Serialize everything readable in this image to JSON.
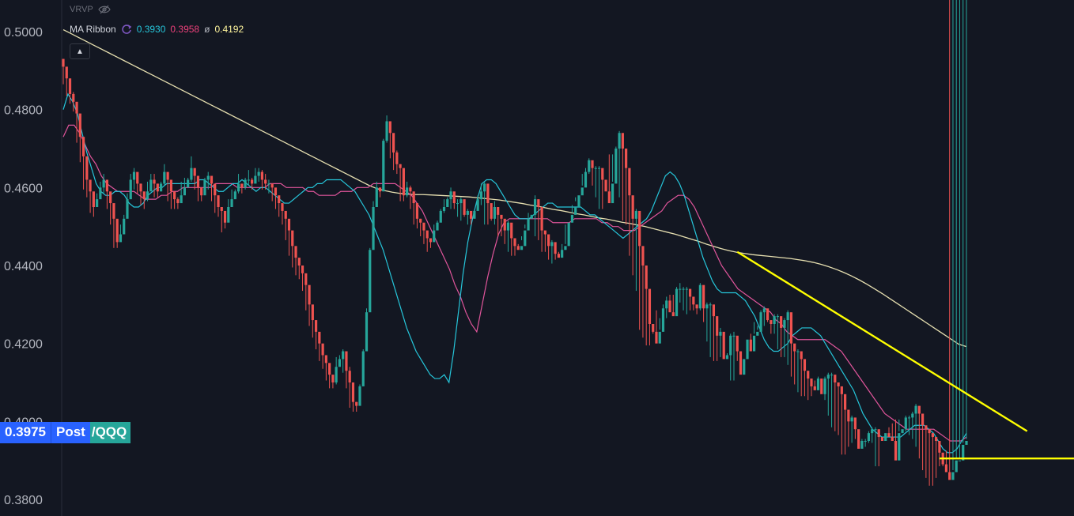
{
  "legend": {
    "vrvp_label": "VRVP",
    "ma_ribbon_label": "MA Ribbon",
    "ma_values": [
      {
        "value": "0.3930",
        "color": "#26c6da"
      },
      {
        "value": "0.3958",
        "color": "#ec407a"
      },
      {
        "value": "0.4192",
        "color": "#fff59d",
        "prefix": "ø"
      }
    ]
  },
  "price_tag": {
    "price": "0.3975",
    "session": "Post",
    "symbol": "/QQQ"
  },
  "colors": {
    "background": "#131722",
    "up": "#26a69a",
    "down": "#ef5350",
    "ma_fast": "#26c6da",
    "ma_mid": "#e0559b",
    "ma_slow": "#e6dfb0",
    "trendline": "#ffff00",
    "accent": "#2962ff"
  },
  "chart_data": {
    "type": "candlestick",
    "ylim": [
      0.3765,
      0.50085
    ],
    "y_ticks": [
      "0.5000",
      "0.4800",
      "0.4600",
      "0.4400",
      "0.4200",
      "0.4000",
      "0.3800"
    ],
    "visible_y_ticks": [
      "0.5000",
      "0.4800",
      "0.4600",
      "0.4400",
      "0.4200",
      "0.3800"
    ],
    "closes": [
      0.491,
      0.488,
      0.484,
      0.482,
      0.479,
      0.473,
      0.468,
      0.462,
      0.459,
      0.455,
      0.457,
      0.46,
      0.462,
      0.459,
      0.456,
      0.452,
      0.446,
      0.448,
      0.452,
      0.457,
      0.462,
      0.464,
      0.461,
      0.459,
      0.457,
      0.459,
      0.462,
      0.461,
      0.459,
      0.461,
      0.464,
      0.462,
      0.459,
      0.457,
      0.456,
      0.458,
      0.46,
      0.462,
      0.465,
      0.463,
      0.46,
      0.458,
      0.462,
      0.463,
      0.461,
      0.458,
      0.455,
      0.454,
      0.451,
      0.455,
      0.457,
      0.459,
      0.461,
      0.46,
      0.462,
      0.462,
      0.461,
      0.463,
      0.464,
      0.462,
      0.461,
      0.461,
      0.46,
      0.458,
      0.456,
      0.454,
      0.452,
      0.449,
      0.445,
      0.442,
      0.44,
      0.438,
      0.435,
      0.43,
      0.426,
      0.423,
      0.42,
      0.417,
      0.415,
      0.412,
      0.41,
      0.414,
      0.416,
      0.418,
      0.413,
      0.41,
      0.405,
      0.404,
      0.409,
      0.418,
      0.428,
      0.444,
      0.455,
      0.46,
      0.459,
      0.472,
      0.477,
      0.474,
      0.469,
      0.466,
      0.465,
      0.458,
      0.46,
      0.459,
      0.456,
      0.452,
      0.451,
      0.449,
      0.447,
      0.446,
      0.449,
      0.451,
      0.454,
      0.455,
      0.457,
      0.459,
      0.456,
      0.456,
      0.457,
      0.453,
      0.454,
      0.452,
      0.454,
      0.457,
      0.459,
      0.461,
      0.456,
      0.452,
      0.455,
      0.453,
      0.452,
      0.449,
      0.451,
      0.447,
      0.445,
      0.444,
      0.445,
      0.449,
      0.452,
      0.453,
      0.457,
      0.455,
      0.449,
      0.448,
      0.445,
      0.446,
      0.443,
      0.442,
      0.444,
      0.445,
      0.451,
      0.453,
      0.455,
      0.458,
      0.46,
      0.464,
      0.467,
      0.465,
      0.465,
      0.465,
      0.462,
      0.459,
      0.456,
      0.461,
      0.47,
      0.474,
      0.47,
      0.465,
      0.458,
      0.452,
      0.454,
      0.445,
      0.44,
      0.434,
      0.425,
      0.423,
      0.42,
      0.423,
      0.429,
      0.431,
      0.428,
      0.427,
      0.434,
      0.434,
      0.434,
      0.434,
      0.432,
      0.43,
      0.429,
      0.435,
      0.429,
      0.43,
      0.43,
      0.427,
      0.422,
      0.423,
      0.416,
      0.417,
      0.422,
      0.422,
      0.418,
      0.412,
      0.416,
      0.421,
      0.418,
      0.422,
      0.423,
      0.428,
      0.429,
      0.426,
      0.425,
      0.427,
      0.427,
      0.424,
      0.426,
      0.428,
      0.42,
      0.418,
      0.418,
      0.416,
      0.413,
      0.411,
      0.409,
      0.408,
      0.411,
      0.407,
      0.411,
      0.412,
      0.412,
      0.41,
      0.409,
      0.407,
      0.403,
      0.4,
      0.401,
      0.398,
      0.393,
      0.395,
      0.395,
      0.397,
      0.398,
      0.398,
      0.396,
      0.395,
      0.397,
      0.396,
      0.395,
      0.39,
      0.397,
      0.398,
      0.401,
      0.401,
      0.402,
      0.404,
      0.402,
      0.399,
      0.398,
      0.397,
      0.396,
      0.395,
      0.392,
      0.389,
      0.387,
      0.385,
      0.387,
      0.39,
      0.39,
      0.394,
      0.395
    ],
    "highs": [
      0.4925,
      0.4905,
      0.486,
      0.4845,
      0.4805,
      0.4745,
      0.4715,
      0.4625,
      0.461,
      0.4575,
      0.4585,
      0.4615,
      0.4635,
      0.462,
      0.4575,
      0.4545,
      0.4495,
      0.4505,
      0.453,
      0.4585,
      0.4635,
      0.465,
      0.4625,
      0.461,
      0.4585,
      0.4615,
      0.4635,
      0.4635,
      0.461,
      0.4615,
      0.466,
      0.4635,
      0.4615,
      0.4575,
      0.4575,
      0.4615,
      0.4625,
      0.4625,
      0.468,
      0.4645,
      0.4615,
      0.459,
      0.4625,
      0.464,
      0.4625,
      0.4595,
      0.458,
      0.4545,
      0.4535,
      0.457,
      0.4595,
      0.4595,
      0.4635,
      0.4605,
      0.4625,
      0.4645,
      0.4625,
      0.465,
      0.465,
      0.4645,
      0.4635,
      0.462,
      0.461,
      0.4595,
      0.4575,
      0.4555,
      0.4525,
      0.4505,
      0.4455,
      0.4425,
      0.4415,
      0.439,
      0.4365,
      0.4305,
      0.427,
      0.4235,
      0.4205,
      0.418,
      0.4155,
      0.4125,
      0.4105,
      0.4165,
      0.417,
      0.4185,
      0.4165,
      0.414,
      0.407,
      0.405,
      0.4095,
      0.4185,
      0.429,
      0.4445,
      0.4565,
      0.4615,
      0.4595,
      0.4725,
      0.4785,
      0.4755,
      0.4715,
      0.4695,
      0.466,
      0.4595,
      0.4615,
      0.4605,
      0.4585,
      0.4535,
      0.452,
      0.45,
      0.4475,
      0.4465,
      0.4505,
      0.4515,
      0.4545,
      0.457,
      0.4575,
      0.46,
      0.4575,
      0.457,
      0.4575,
      0.4545,
      0.4545,
      0.4525,
      0.4545,
      0.458,
      0.461,
      0.4615,
      0.4575,
      0.4535,
      0.4565,
      0.454,
      0.4525,
      0.4505,
      0.4515,
      0.4475,
      0.446,
      0.4455,
      0.4465,
      0.4495,
      0.4535,
      0.4545,
      0.458,
      0.4565,
      0.4495,
      0.4485,
      0.4455,
      0.4465,
      0.4435,
      0.4425,
      0.4455,
      0.4455,
      0.4525,
      0.4535,
      0.4565,
      0.4585,
      0.4605,
      0.465,
      0.4675,
      0.4665,
      0.4655,
      0.4655,
      0.4635,
      0.4595,
      0.4565,
      0.4615,
      0.4705,
      0.4745,
      0.4705,
      0.4655,
      0.4585,
      0.4535,
      0.4545,
      0.4465,
      0.4405,
      0.4345,
      0.4255,
      0.424,
      0.4205,
      0.4235,
      0.43,
      0.432,
      0.4285,
      0.4275,
      0.4345,
      0.4355,
      0.4345,
      0.4345,
      0.4325,
      0.4305,
      0.4295,
      0.4355,
      0.4295,
      0.4305,
      0.4305,
      0.4275,
      0.4225,
      0.424,
      0.4165,
      0.4175,
      0.4225,
      0.423,
      0.4185,
      0.4125,
      0.4165,
      0.4215,
      0.4185,
      0.4225,
      0.4235,
      0.4285,
      0.4295,
      0.4265,
      0.4255,
      0.4275,
      0.4275,
      0.4245,
      0.4265,
      0.4285,
      0.4205,
      0.4185,
      0.4185,
      0.4165,
      0.4135,
      0.4115,
      0.4095,
      0.4085,
      0.4115,
      0.4075,
      0.4115,
      0.4125,
      0.4125,
      0.4105,
      0.4095,
      0.4075,
      0.4035,
      0.4005,
      0.4015,
      0.3985,
      0.3935,
      0.3955,
      0.3955,
      0.3975,
      0.3985,
      0.3985,
      0.3965,
      0.3955,
      0.3975,
      0.3965,
      0.3955,
      0.3905,
      0.3975,
      0.3985,
      0.4015,
      0.4015,
      0.4025,
      0.4045,
      0.4025,
      0.3995,
      0.3985,
      0.3975,
      0.3965,
      0.3955,
      0.3925,
      0.3895,
      0.3875,
      0.3855,
      0.3875,
      0.3905,
      0.3905,
      0.3945,
      0.3955
    ],
    "lows": [
      0.4865,
      0.4835,
      0.4815,
      0.4795,
      0.4715,
      0.4665,
      0.4595,
      0.4575,
      0.4535,
      0.4525,
      0.4555,
      0.4575,
      0.4585,
      0.4545,
      0.4505,
      0.4445,
      0.4445,
      0.4465,
      0.4505,
      0.4545,
      0.4595,
      0.4595,
      0.4585,
      0.4555,
      0.4545,
      0.4565,
      0.4595,
      0.4575,
      0.4575,
      0.4595,
      0.4605,
      0.4565,
      0.4545,
      0.4545,
      0.4545,
      0.4565,
      0.4585,
      0.4605,
      0.4615,
      0.4595,
      0.4565,
      0.4565,
      0.4595,
      0.4595,
      0.4565,
      0.4535,
      0.4525,
      0.4485,
      0.4495,
      0.4525,
      0.4555,
      0.4575,
      0.4585,
      0.4585,
      0.4595,
      0.4605,
      0.4595,
      0.4615,
      0.4615,
      0.4595,
      0.4595,
      0.4585,
      0.4565,
      0.4545,
      0.4525,
      0.4505,
      0.4465,
      0.4425,
      0.4395,
      0.4375,
      0.4365,
      0.4335,
      0.4285,
      0.4245,
      0.4215,
      0.4185,
      0.4155,
      0.4135,
      0.4105,
      0.4085,
      0.4085,
      0.4095,
      0.4145,
      0.4125,
      0.4085,
      0.4035,
      0.4025,
      0.4025,
      0.4075,
      0.4165,
      0.4265,
      0.4425,
      0.4535,
      0.4575,
      0.4575,
      0.4685,
      0.4715,
      0.4675,
      0.4645,
      0.4635,
      0.4565,
      0.4565,
      0.4575,
      0.4545,
      0.4505,
      0.4495,
      0.4475,
      0.4455,
      0.4435,
      0.4445,
      0.4475,
      0.4495,
      0.4535,
      0.4535,
      0.4555,
      0.4545,
      0.4545,
      0.4525,
      0.4515,
      0.4525,
      0.4505,
      0.4505,
      0.4545,
      0.4565,
      0.4555,
      0.4505,
      0.4505,
      0.4515,
      0.4505,
      0.4475,
      0.4475,
      0.4455,
      0.4435,
      0.4425,
      0.4425,
      0.4445,
      0.4475,
      0.4505,
      0.4515,
      0.4545,
      0.4475,
      0.4465,
      0.4435,
      0.4435,
      0.4415,
      0.4405,
      0.4415,
      0.4435,
      0.4435,
      0.4505,
      0.4525,
      0.4555,
      0.4575,
      0.4585,
      0.4635,
      0.4635,
      0.4635,
      0.4605,
      0.4575,
      0.4545,
      0.4545,
      0.4595,
      0.4685,
      0.4685,
      0.4635,
      0.4575,
      0.4515,
      0.4505,
      0.4425,
      0.4375,
      0.4335,
      0.4235,
      0.4215,
      0.4195,
      0.4195,
      0.4225,
      0.4285,
      0.4265,
      0.4255,
      0.4265,
      0.4325,
      0.4325,
      0.4325,
      0.4305,
      0.4285,
      0.4275,
      0.4285,
      0.4285,
      0.4275,
      0.4285,
      0.4255,
      0.4205,
      0.4165,
      0.4155,
      0.4155,
      0.4165,
      0.4205,
      0.4165,
      0.4105,
      0.4105,
      0.4155,
      0.4165,
      0.4165,
      0.4215,
      0.4225,
      0.4255,
      0.4245,
      0.4235,
      0.4245,
      0.4255,
      0.4225,
      0.4225,
      0.4185,
      0.4165,
      0.4165,
      0.4145,
      0.4115,
      0.4095,
      0.4075,
      0.4065,
      0.4065,
      0.4055,
      0.4065,
      0.4105,
      0.4095,
      0.4075,
      0.4055,
      0.4015,
      0.3985,
      0.3975,
      0.3965,
      0.3915,
      0.3915,
      0.3935,
      0.3945,
      0.3955,
      0.3955,
      0.3945,
      0.3935,
      0.3945,
      0.3945,
      0.3885,
      0.3885,
      0.3955,
      0.3975,
      0.3985,
      0.3995,
      0.4005,
      0.4005,
      0.3985,
      0.3975,
      0.3965,
      0.3955,
      0.3935,
      0.3905,
      0.3875,
      0.3855,
      0.3835,
      0.3835,
      0.3855,
      0.3885,
      0.3885,
      0.3925
    ],
    "ma_fast": [
      0.48,
      0.484,
      0.482,
      0.479,
      0.474,
      0.469,
      0.465,
      0.461,
      0.459,
      0.458,
      0.458,
      0.459,
      0.459,
      0.458,
      0.456,
      0.455,
      0.455,
      0.456,
      0.458,
      0.459,
      0.46,
      0.46,
      0.461,
      0.461,
      0.461,
      0.461,
      0.461,
      0.461,
      0.461,
      0.462,
      0.462,
      0.461,
      0.46,
      0.459,
      0.459,
      0.46,
      0.461,
      0.461,
      0.462,
      0.461,
      0.46,
      0.459,
      0.46,
      0.46,
      0.459,
      0.458,
      0.457,
      0.456,
      0.456,
      0.457,
      0.458,
      0.459,
      0.46,
      0.46,
      0.461,
      0.461,
      0.462,
      0.462,
      0.462,
      0.462,
      0.461,
      0.46,
      0.459,
      0.457,
      0.455,
      0.453,
      0.45,
      0.447,
      0.444,
      0.44,
      0.436,
      0.432,
      0.428,
      0.424,
      0.421,
      0.418,
      0.416,
      0.414,
      0.412,
      0.411,
      0.411,
      0.412,
      0.41,
      0.418,
      0.428,
      0.438,
      0.446,
      0.452,
      0.457,
      0.461,
      0.462,
      0.462,
      0.461,
      0.459,
      0.457,
      0.455,
      0.453,
      0.452,
      0.452,
      0.452,
      0.453,
      0.454,
      0.455,
      0.456,
      0.456,
      0.455,
      0.455,
      0.455,
      0.455,
      0.455,
      0.455,
      0.454,
      0.453,
      0.453,
      0.452,
      0.451,
      0.45,
      0.449,
      0.448,
      0.447,
      0.448,
      0.449,
      0.45,
      0.451,
      0.452,
      0.454,
      0.457,
      0.46,
      0.463,
      0.464,
      0.463,
      0.461,
      0.458,
      0.454,
      0.45,
      0.446,
      0.442,
      0.439,
      0.436,
      0.434,
      0.433,
      0.433,
      0.433,
      0.433,
      0.432,
      0.431,
      0.429,
      0.427,
      0.424,
      0.421,
      0.419,
      0.418,
      0.418,
      0.419,
      0.42,
      0.422,
      0.423,
      0.424,
      0.424,
      0.424,
      0.423,
      0.422,
      0.42,
      0.418,
      0.416,
      0.414,
      0.412,
      0.41,
      0.408,
      0.405,
      0.402,
      0.4,
      0.398,
      0.397,
      0.396,
      0.396,
      0.396,
      0.396,
      0.396,
      0.397,
      0.398,
      0.399,
      0.399,
      0.399,
      0.398,
      0.397,
      0.395,
      0.393,
      0.392,
      0.392,
      0.393,
      0.395,
      0.397
    ],
    "ma_mid": [
      0.473,
      0.476,
      0.476,
      0.474,
      0.471,
      0.468,
      0.466,
      0.463,
      0.461,
      0.46,
      0.459,
      0.459,
      0.459,
      0.459,
      0.458,
      0.457,
      0.457,
      0.457,
      0.458,
      0.458,
      0.459,
      0.459,
      0.46,
      0.46,
      0.46,
      0.46,
      0.46,
      0.46,
      0.461,
      0.461,
      0.461,
      0.461,
      0.46,
      0.46,
      0.46,
      0.46,
      0.46,
      0.46,
      0.461,
      0.461,
      0.461,
      0.46,
      0.46,
      0.46,
      0.46,
      0.459,
      0.459,
      0.458,
      0.458,
      0.458,
      0.458,
      0.459,
      0.459,
      0.459,
      0.46,
      0.46,
      0.46,
      0.461,
      0.461,
      0.461,
      0.461,
      0.461,
      0.46,
      0.459,
      0.458,
      0.456,
      0.454,
      0.451,
      0.448,
      0.445,
      0.442,
      0.439,
      0.435,
      0.432,
      0.428,
      0.425,
      0.423,
      0.43,
      0.437,
      0.443,
      0.448,
      0.451,
      0.452,
      0.452,
      0.452,
      0.452,
      0.452,
      0.452,
      0.452,
      0.452,
      0.451,
      0.451,
      0.451,
      0.451,
      0.452,
      0.452,
      0.452,
      0.452,
      0.452,
      0.451,
      0.451,
      0.45,
      0.45,
      0.449,
      0.449,
      0.449,
      0.45,
      0.451,
      0.452,
      0.453,
      0.454,
      0.456,
      0.457,
      0.458,
      0.458,
      0.457,
      0.455,
      0.452,
      0.449,
      0.446,
      0.443,
      0.44,
      0.438,
      0.436,
      0.434,
      0.433,
      0.432,
      0.431,
      0.43,
      0.429,
      0.428,
      0.426,
      0.425,
      0.423,
      0.422,
      0.421,
      0.421,
      0.421,
      0.421,
      0.421,
      0.421,
      0.42,
      0.419,
      0.418,
      0.416,
      0.414,
      0.412,
      0.41,
      0.408,
      0.406,
      0.404,
      0.402,
      0.401,
      0.4,
      0.399,
      0.398,
      0.398,
      0.398,
      0.398,
      0.398,
      0.398,
      0.397,
      0.396,
      0.395,
      0.395,
      0.395,
      0.396
    ],
    "ma_slow": [
      0.5005,
      0.4995,
      0.4985,
      0.4975,
      0.4965,
      0.4955,
      0.4945,
      0.4935,
      0.4925,
      0.4915,
      0.4905,
      0.4895,
      0.4885,
      0.4875,
      0.4865,
      0.4855,
      0.4845,
      0.4835,
      0.4825,
      0.4815,
      0.4805,
      0.4795,
      0.4785,
      0.4775,
      0.4765,
      0.4755,
      0.4745,
      0.4735,
      0.4725,
      0.4715,
      0.4705,
      0.4695,
      0.4685,
      0.4675,
      0.4665,
      0.4655,
      0.4645,
      0.4635,
      0.4625,
      0.4615,
      0.4605,
      0.4597,
      0.4592,
      0.4588,
      0.4585,
      0.4583,
      0.4582,
      0.4582,
      0.4581,
      0.458,
      0.4579,
      0.4578,
      0.4577,
      0.4576,
      0.4574,
      0.4572,
      0.457,
      0.4568,
      0.4565,
      0.4562,
      0.4559,
      0.4555,
      0.4552,
      0.4548,
      0.4544,
      0.4541,
      0.4537,
      0.4533,
      0.453,
      0.4526,
      0.4522,
      0.4519,
      0.4515,
      0.4511,
      0.4508,
      0.4504,
      0.45,
      0.4495,
      0.449,
      0.4485,
      0.448,
      0.4474,
      0.4468,
      0.4462,
      0.4455,
      0.4449,
      0.4443,
      0.4438,
      0.4434,
      0.4431,
      0.4428,
      0.4426,
      0.4424,
      0.4422,
      0.442,
      0.4418,
      0.4415,
      0.4412,
      0.4408,
      0.4403,
      0.4397,
      0.439,
      0.4382,
      0.4373,
      0.4363,
      0.4352,
      0.434,
      0.4328,
      0.4315,
      0.4302,
      0.4289,
      0.4276,
      0.4263,
      0.425,
      0.4237,
      0.4224,
      0.4211,
      0.4198,
      0.4192
    ],
    "trendlines": [
      {
        "from": {
          "i": 200,
          "y": 0.4435
        },
        "to": {
          "i": 286,
          "y": 0.3975
        }
      },
      {
        "from": {
          "i": 260,
          "y": 0.3905
        },
        "to": {
          "i": 300,
          "y": 0.3905
        }
      }
    ]
  }
}
